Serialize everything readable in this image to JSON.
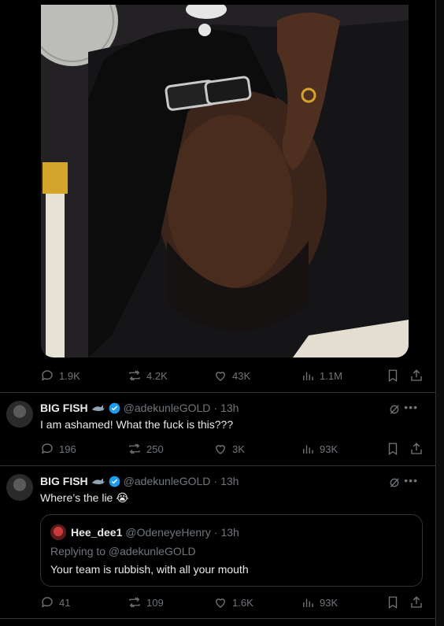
{
  "top_tweet": {
    "actions": {
      "replies": "1.9K",
      "reposts": "4.2K",
      "likes": "43K",
      "views": "1.1M"
    }
  },
  "tweets": [
    {
      "name": "BIG FISH",
      "handle": "@adekunleGOLD",
      "time": "13h",
      "text": "I am ashamed! What the fuck is this???",
      "actions": {
        "replies": "196",
        "reposts": "250",
        "likes": "3K",
        "views": "93K"
      }
    },
    {
      "name": "BIG FISH",
      "handle": "@adekunleGOLD",
      "time": "13h",
      "text": "Where’s the lie 😭",
      "quote": {
        "name": "Hee_dee1",
        "handle": "@OdeneyeHenry",
        "time": "13h",
        "replying": "Replying to @adekunleGOLD",
        "text": "Your team is rubbish, with all your mouth"
      },
      "actions": {
        "replies": "41",
        "reposts": "109",
        "likes": "1.6K",
        "views": "93K"
      }
    }
  ],
  "separator": "·",
  "colors": {
    "background": "#000000",
    "text": "#e7e9ea",
    "muted": "#71767b",
    "border": "#2f3336",
    "verified": "#1d9bf0"
  },
  "icons": [
    "reply-icon",
    "repost-icon",
    "like-icon",
    "views-icon",
    "bookmark-icon",
    "share-icon",
    "grok-icon",
    "more-icon",
    "verified-icon",
    "shark-icon"
  ]
}
